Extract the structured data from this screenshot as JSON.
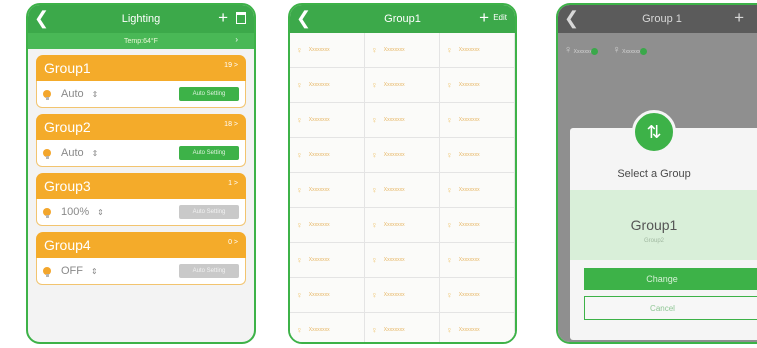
{
  "screen1": {
    "title": "Lighting",
    "temp": "Temp:64°F",
    "groups": [
      {
        "name": "Group1",
        "badge": "19 >",
        "mode": "Auto",
        "button": "Auto Setting"
      },
      {
        "name": "Group2",
        "badge": "18 >",
        "mode": "Auto",
        "button": "Auto Setting"
      },
      {
        "name": "Group3",
        "badge": "1 >",
        "mode": "100%",
        "button": "Auto Setting"
      },
      {
        "name": "Group4",
        "badge": "0 >",
        "mode": "OFF",
        "button": "Auto Setting"
      }
    ]
  },
  "screen2": {
    "title": "Group1",
    "edit": "Edit",
    "cell_label": "Xxxxxxxx"
  },
  "screen3": {
    "title": "Group 1",
    "nav_right": "Ca",
    "dialog_title": "Select a Group",
    "selected": "Group1",
    "selected_sub": "Group2",
    "change": "Change",
    "cancel": "Cancel"
  }
}
